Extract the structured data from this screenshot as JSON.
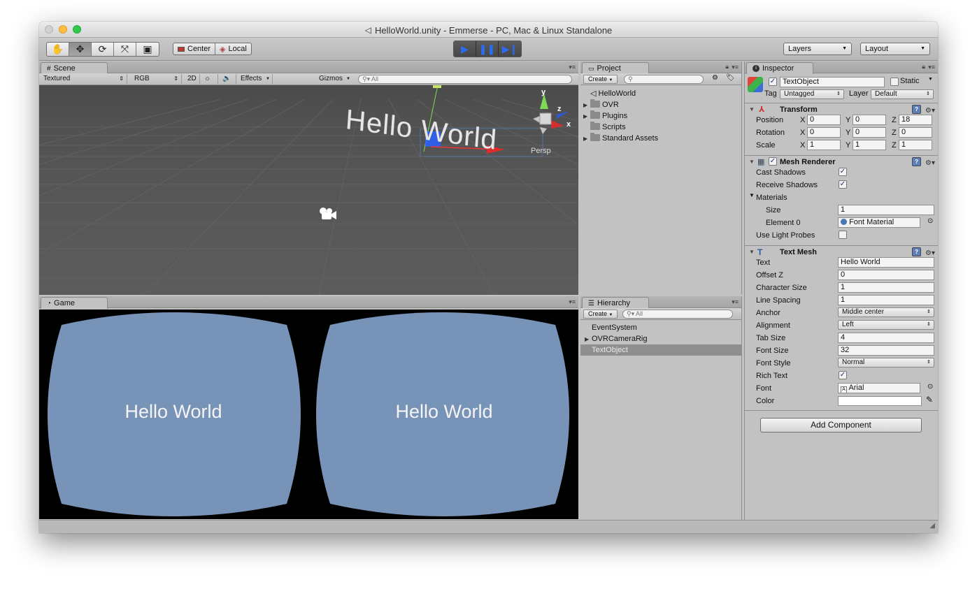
{
  "window": {
    "title": "HelloWorld.unity - Emmerse - PC, Mac & Linux Standalone"
  },
  "toolbar": {
    "tools": [
      "hand-icon",
      "move-icon",
      "rotate-icon",
      "scale-icon",
      "rect-icon"
    ],
    "pivot_center": "Center",
    "pivot_local": "Local",
    "layers": "Layers",
    "layout": "Layout"
  },
  "scene": {
    "tab": "Scene",
    "shading": "Textured",
    "channel": "RGB",
    "mode_2d": "2D",
    "effects": "Effects",
    "gizmos": "Gizmos",
    "search_placeholder": "All",
    "world_text": "Hello World",
    "persp": "Persp",
    "axis_y": "y",
    "axis_z": "z",
    "axis_x": "x"
  },
  "game": {
    "tab": "Game",
    "left_text": "Hello World",
    "right_text": "Hello World",
    "lens_color": "#7893b8"
  },
  "project": {
    "tab": "Project",
    "create": "Create",
    "items": [
      "HelloWorld",
      "OVR",
      "Plugins",
      "Scripts",
      "Standard Assets"
    ]
  },
  "hierarchy": {
    "tab": "Hierarchy",
    "create": "Create",
    "search_placeholder": "All",
    "items": [
      "EventSystem",
      "OVRCameraRig",
      "TextObject"
    ]
  },
  "inspector": {
    "tab": "Inspector",
    "object_name": "TextObject",
    "static_label": "Static",
    "tag_label": "Tag",
    "tag_value": "Untagged",
    "layer_label": "Layer",
    "layer_value": "Default",
    "transform": {
      "title": "Transform",
      "position_label": "Position",
      "rotation_label": "Rotation",
      "scale_label": "Scale",
      "position": [
        "0",
        "0",
        "18"
      ],
      "rotation": [
        "0",
        "0",
        "0"
      ],
      "scale": [
        "1",
        "1",
        "1"
      ],
      "x": "X",
      "y": "Y",
      "z": "Z"
    },
    "mesh_renderer": {
      "title": "Mesh Renderer",
      "cast_shadows": "Cast Shadows",
      "receive_shadows": "Receive Shadows",
      "materials": "Materials",
      "size_label": "Size",
      "size_value": "1",
      "element0_label": "Element 0",
      "element0_value": "Font Material",
      "use_light_probes": "Use Light Probes"
    },
    "text_mesh": {
      "title": "Text Mesh",
      "text_label": "Text",
      "text_value": "Hello World",
      "offset_z_label": "Offset Z",
      "offset_z_value": "0",
      "char_size_label": "Character Size",
      "char_size_value": "1",
      "line_spacing_label": "Line Spacing",
      "line_spacing_value": "1",
      "anchor_label": "Anchor",
      "anchor_value": "Middle center",
      "alignment_label": "Alignment",
      "alignment_value": "Left",
      "tab_size_label": "Tab Size",
      "tab_size_value": "4",
      "font_size_label": "Font Size",
      "font_size_value": "32",
      "font_style_label": "Font Style",
      "font_style_value": "Normal",
      "rich_text_label": "Rich Text",
      "font_label": "Font",
      "font_value": "Arial",
      "color_label": "Color"
    },
    "add_component": "Add Component"
  }
}
